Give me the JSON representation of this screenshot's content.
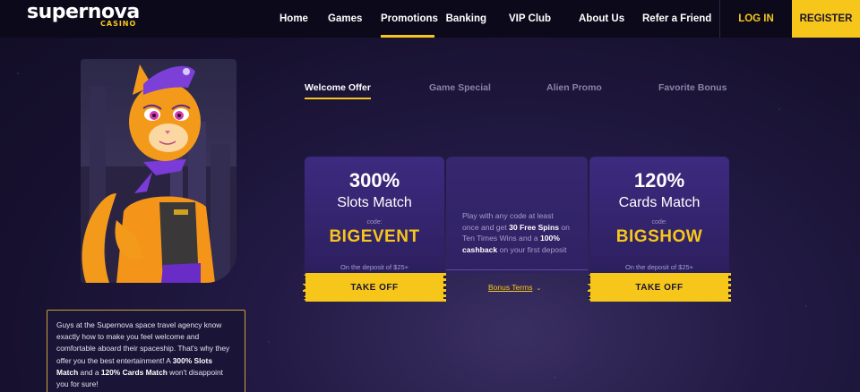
{
  "logo": {
    "main": "supernova",
    "sub": "CASINO"
  },
  "nav": {
    "items": [
      {
        "label": "Home"
      },
      {
        "label": "Games"
      },
      {
        "label": "Promotions",
        "active": true
      },
      {
        "label": "Banking"
      },
      {
        "label": "VIP Club"
      },
      {
        "label": "About Us"
      },
      {
        "label": "Refer a Friend"
      }
    ],
    "login": "LOG IN",
    "register": "REGISTER"
  },
  "description": {
    "p1": "Guys at the Supernova space travel agency know exactly how to make you feel welcome and comfortable aboard their spaceship. That's why they offer you the best entertainment! A ",
    "b1": "300% Slots Match",
    "p2": " and a ",
    "b2": "120% Cards Match",
    "p3": " won't disappoint you for sure!"
  },
  "tabs": [
    {
      "label": "Welcome Offer",
      "active": true
    },
    {
      "label": "Game Special"
    },
    {
      "label": "Alien Promo"
    },
    {
      "label": "Favorite Bonus"
    }
  ],
  "offers": {
    "slots": {
      "percent": "300%",
      "name": "Slots Match",
      "code_label": "code:",
      "code": "BIGEVENT",
      "deposit": "On the deposit of $25+",
      "button": "TAKE OFF"
    },
    "middle": {
      "t1": "Play with any code at least once and get ",
      "b1": "30 Free Spins",
      "t2": " on Ten Times Wins and a ",
      "b2": "100% cashback",
      "t3": " on your first deposit",
      "link": "Bonus Terms"
    },
    "cards": {
      "percent": "120%",
      "name": "Cards Match",
      "code_label": "code:",
      "code": "BIGSHOW",
      "deposit": "On the deposit of $25+",
      "button": "TAKE OFF"
    }
  },
  "colors": {
    "accent": "#f7c61b",
    "background": "#1b1438",
    "card": "#3a2878"
  }
}
